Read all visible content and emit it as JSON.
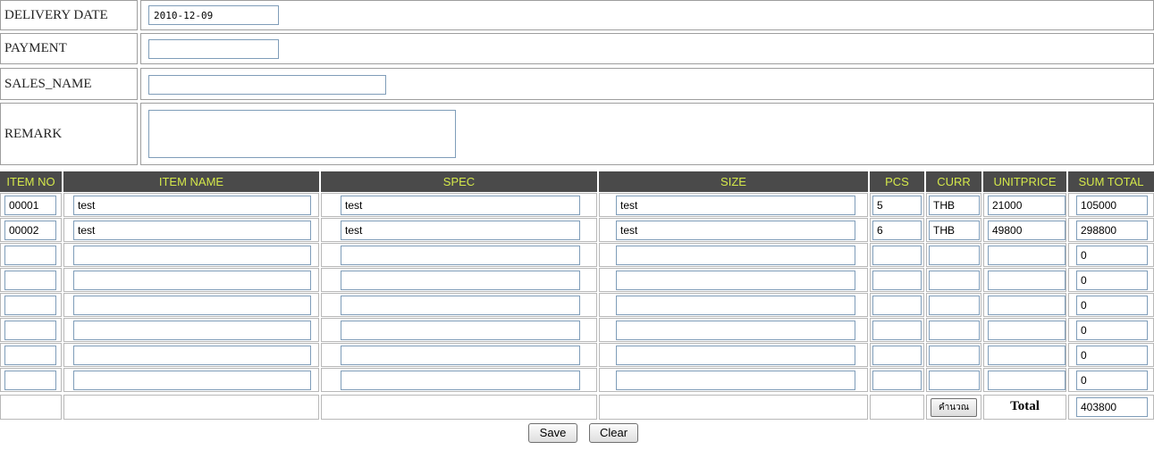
{
  "form": {
    "delivery_date_label": "DELIVERY DATE",
    "delivery_date_value": "2010-12-09",
    "payment_label": "PAYMENT",
    "payment_value": "",
    "sales_name_label": "SALES_NAME",
    "sales_name_value": "",
    "remark_label": "REMARK",
    "remark_value": ""
  },
  "items": {
    "headers": [
      "ITEM NO",
      "ITEM NAME",
      "SPEC",
      "SIZE",
      "PCS",
      "CURR",
      "UNITPRICE",
      "SUM TOTAL"
    ],
    "rows": [
      [
        "00001",
        "test",
        "test",
        "test",
        "5",
        "THB",
        "21000",
        "105000"
      ],
      [
        "00002",
        "test",
        "test",
        "test",
        "6",
        "THB",
        "49800",
        "298800"
      ],
      [
        "",
        "",
        "",
        "",
        "",
        "",
        "",
        "0"
      ],
      [
        "",
        "",
        "",
        "",
        "",
        "",
        "",
        "0"
      ],
      [
        "",
        "",
        "",
        "",
        "",
        "",
        "",
        "0"
      ],
      [
        "",
        "",
        "",
        "",
        "",
        "",
        "",
        "0"
      ],
      [
        "",
        "",
        "",
        "",
        "",
        "",
        "",
        "0"
      ],
      [
        "",
        "",
        "",
        "",
        "",
        "",
        "",
        "0"
      ]
    ]
  },
  "footer": {
    "calculate_label": "คำนวณ",
    "total_label": "Total",
    "total_value": "403800"
  },
  "buttons": {
    "save_label": "Save",
    "clear_label": "Clear"
  },
  "colors": {
    "header_bg": "#4a4a4a",
    "header_text": "#d4e84a",
    "input_border": "#7f9db9"
  }
}
